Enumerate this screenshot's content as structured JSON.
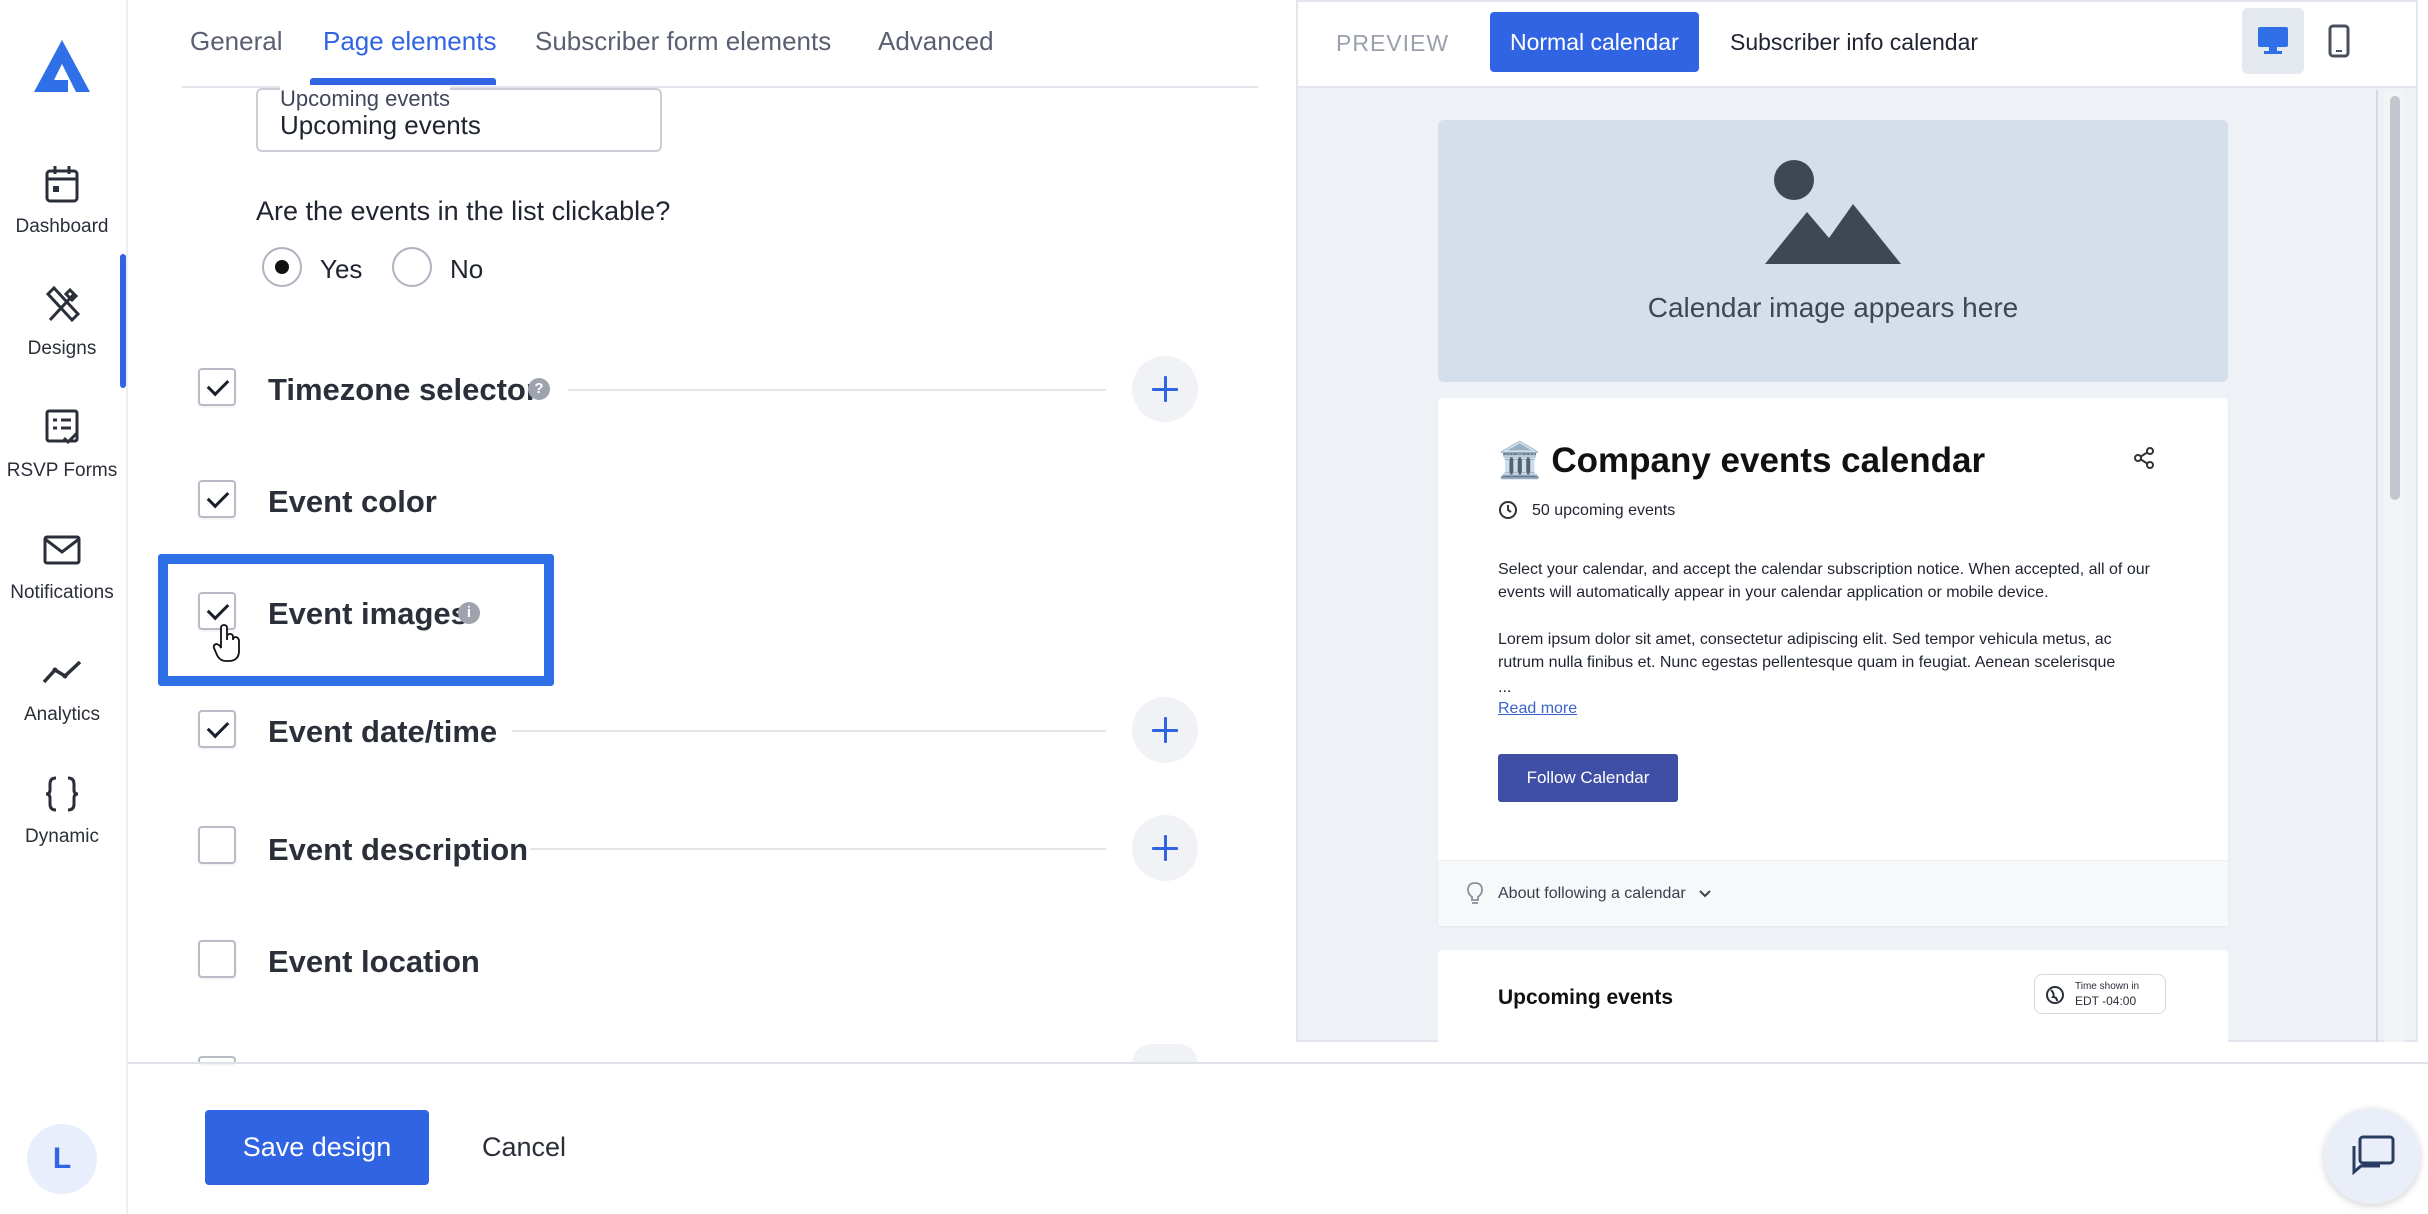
{
  "sidebar": {
    "items": [
      {
        "label": "Dashboard"
      },
      {
        "label": "Designs"
      },
      {
        "label": "RSVP Forms"
      },
      {
        "label": "Notifications"
      },
      {
        "label": "Analytics"
      },
      {
        "label": "Dynamic"
      }
    ],
    "active": "Designs",
    "avatar_initial": "L"
  },
  "tabs": [
    "General",
    "Page elements",
    "Subscriber form elements",
    "Advanced"
  ],
  "active_tab": "Page elements",
  "form": {
    "list_title_field": {
      "floating_label": "Upcoming events",
      "value": "Upcoming events"
    },
    "clickable_question": "Are the events in the list clickable?",
    "clickable_options": {
      "yes": "Yes",
      "no": "No",
      "selected": "Yes"
    },
    "elements": [
      {
        "label": "Timezone selector",
        "checked": true
      },
      {
        "label": "Event color",
        "checked": true
      },
      {
        "label": "Event images",
        "checked": true
      },
      {
        "label": "Event date/time",
        "checked": true
      },
      {
        "label": "Event description",
        "checked": false
      },
      {
        "label": "Event location",
        "checked": false
      }
    ]
  },
  "actions": {
    "save": "Save design",
    "cancel": "Cancel"
  },
  "preview": {
    "label": "PREVIEW",
    "tabs": {
      "normal": "Normal calendar",
      "subscriber": "Subscriber info calendar"
    },
    "image_placeholder": "Calendar image appears here",
    "calendar": {
      "icon": "🏛️",
      "title": "Company events calendar",
      "count": "50 upcoming events",
      "desc1": "Select your calendar, and accept the calendar subscription notice. When accepted, all of our events will automatically appear in your calendar application or mobile device.",
      "desc2": "Lorem ipsum dolor sit amet, consectetur adipiscing elit. Sed tempor vehicula metus, ac rutrum nulla finibus et. Nunc egestas pellentesque quam in feugiat. Aenean scelerisque",
      "ellipsis": "...",
      "read_more": "Read more",
      "follow": "Follow Calendar",
      "about": "About following a calendar"
    },
    "upcoming": {
      "title": "Upcoming events",
      "tz_line1": "Time shown in",
      "tz_line2": "EDT -04:00"
    }
  },
  "colors": {
    "accent": "#3164e2",
    "highlight": "#2f6fe8",
    "follow_button": "#3f4fa6"
  }
}
